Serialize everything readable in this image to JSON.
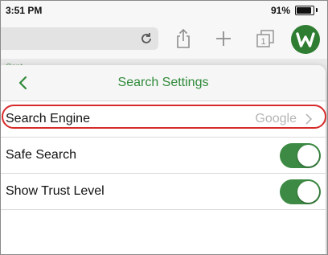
{
  "status_bar": {
    "time": "3:51 PM",
    "battery": "91%"
  },
  "background": {
    "link_text": "Cont"
  },
  "panel": {
    "title": "Search Settings",
    "rows": [
      {
        "label": "Search Engine",
        "value": "Google",
        "type": "disclosure"
      },
      {
        "label": "Safe Search",
        "type": "toggle",
        "on": true
      },
      {
        "label": "Show Trust Level",
        "type": "toggle",
        "on": true
      }
    ]
  },
  "colors": {
    "accent": "#2f8a3a",
    "toggle_on": "#3c8a43",
    "highlight": "#d62b2b"
  }
}
